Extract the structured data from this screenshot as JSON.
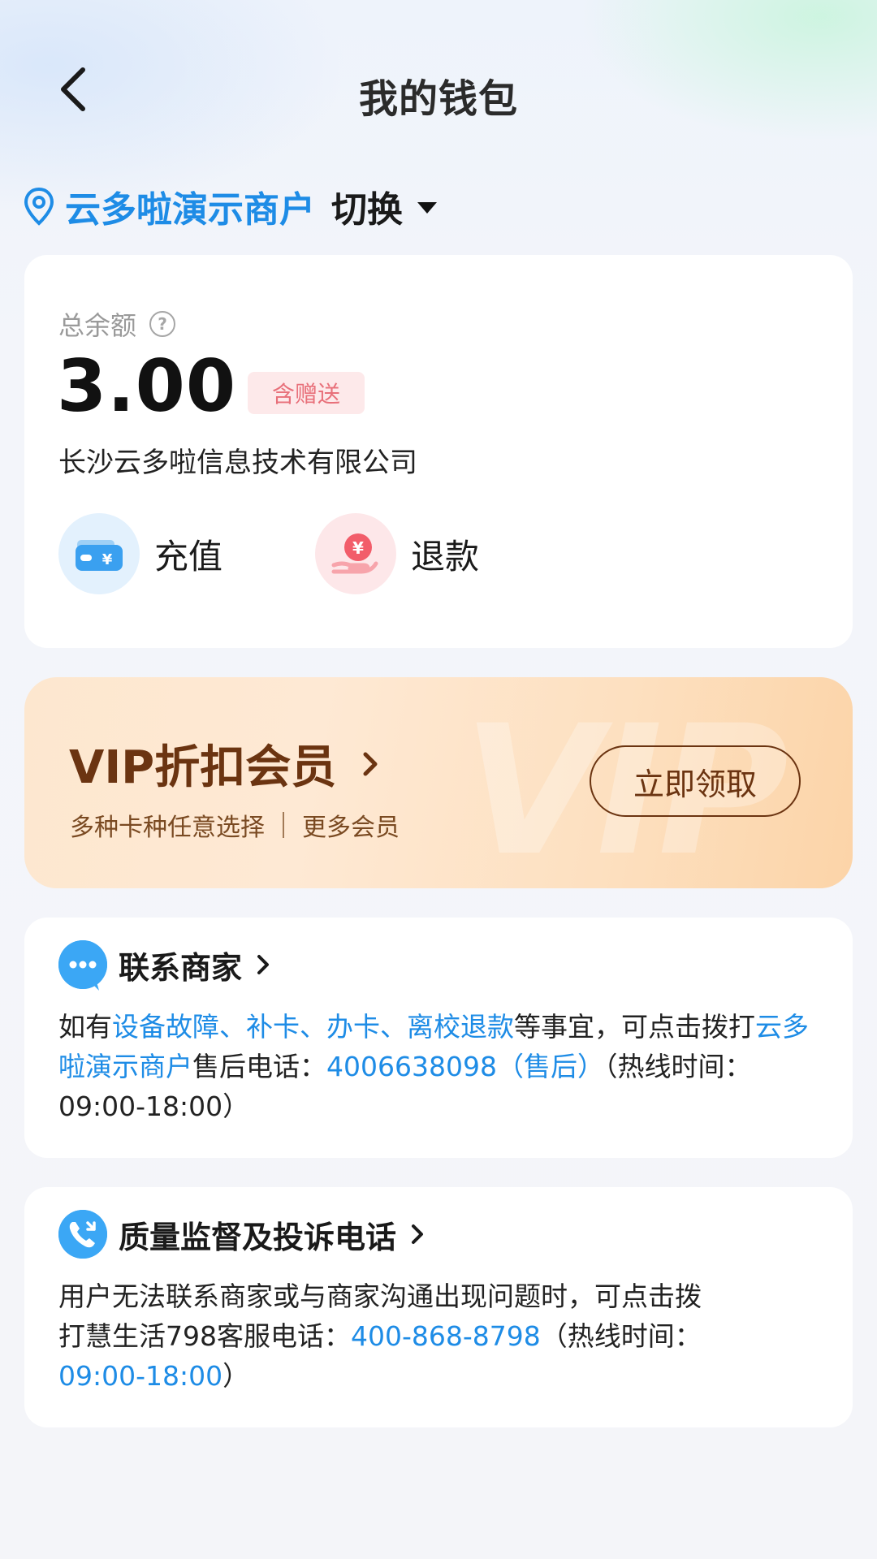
{
  "header": {
    "title": "我的钱包"
  },
  "merchant": {
    "name": "云多啦演示商户",
    "switch_label": "切换"
  },
  "balance": {
    "label": "总余额",
    "amount": "3.00",
    "badge": "含赠送",
    "company": "长沙云多啦信息技术有限公司",
    "actions": [
      {
        "label": "充值",
        "icon": "wallet-icon"
      },
      {
        "label": "退款",
        "icon": "refund-hand-icon"
      }
    ]
  },
  "vip": {
    "title": "VIP折扣会员",
    "subtitle_left": "多种卡种任意选择",
    "subtitle_right": "更多会员",
    "button": "立即领取",
    "watermark": "VIP"
  },
  "contact": {
    "title": "联系商家",
    "p1": "如有",
    "p2": "设备故障、补卡、办卡、离校退款",
    "p3": "等事宜，可点击拨打",
    "p4": "云多啦演示商户",
    "p5": "售后电话：",
    "p6": "4006638098（售后）",
    "p7": "（热线时间：09:00-18:00）"
  },
  "quality": {
    "title": "质量监督及投诉电话",
    "line1": "用户无法联系商家或与商家沟通出现问题时，可点击拨",
    "line2": "打慧生活798客服电话：",
    "phone": "400-868-8798",
    "line3": "（热线时间：",
    "hours": "09:00-18:00",
    "close": "）"
  },
  "colors": {
    "accent_blue": "#1e8ce6",
    "vip_brown": "#6b3411",
    "badge_red": "#e8707a"
  }
}
